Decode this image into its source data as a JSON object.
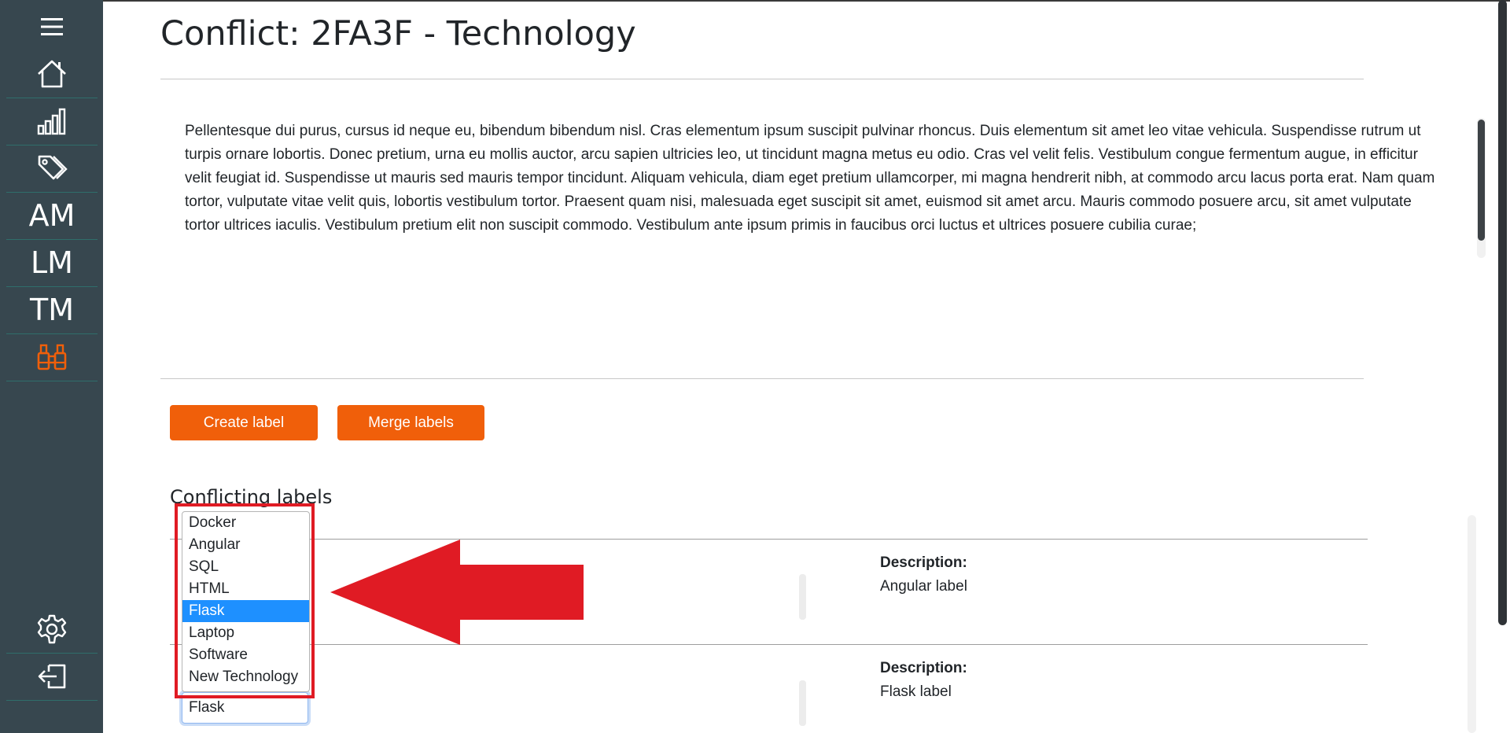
{
  "sidebar": {
    "items": [
      {
        "icon": "menu-icon"
      },
      {
        "icon": "home-icon"
      },
      {
        "icon": "bar-chart-icon"
      },
      {
        "icon": "tags-icon"
      },
      {
        "label": "AM"
      },
      {
        "label": "LM"
      },
      {
        "label": "TM"
      },
      {
        "icon": "binoculars-icon",
        "active_color": "#f05f0a"
      },
      {
        "icon": "gear-icon"
      },
      {
        "icon": "logout-icon"
      }
    ]
  },
  "page": {
    "title": "Conflict: 2FA3F - Technology",
    "paragraph": "Pellentesque dui purus, cursus id neque eu, bibendum bibendum nisl. Cras elementum ipsum suscipit pulvinar rhoncus. Duis elementum sit amet leo vitae vehicula. Suspendisse rutrum ut turpis ornare lobortis. Donec pretium, urna eu mollis auctor, arcu sapien ultricies leo, ut tincidunt magna metus eu odio. Cras vel velit felis. Vestibulum congue fermentum augue, in efficitur velit feugiat id. Suspendisse ut mauris sed mauris tempor tincidunt. Aliquam vehicula, diam eget pretium ullamcorper, mi magna hendrerit nibh, at commodo arcu lacus porta erat. Nam quam tortor, vulputate vitae velit quis, lobortis vestibulum tortor. Praesent quam nisi, malesuada eget suscipit sit amet, euismod sit amet arcu. Mauris commodo posuere arcu, sit amet vulputate tortor ultrices iaculis. Vestibulum pretium elit non suscipit commodo. Vestibulum ante ipsum primis in faucibus orci luctus et ultrices posuere cubilia curae;"
  },
  "actions": {
    "create_label": "Create label",
    "merge_labels": "Merge labels"
  },
  "conflicting": {
    "title": "Conflicting labels",
    "rows": [
      {
        "description_label": "Description:",
        "description": "Angular label"
      },
      {
        "description_label": "Description:",
        "description": "Flask label",
        "selected_value": "Flask"
      }
    ]
  },
  "dropdown": {
    "options": [
      "Docker",
      "Angular",
      "SQL",
      "HTML",
      "Flask",
      "Laptop",
      "Software",
      "New Technology"
    ],
    "highlighted": "Flask"
  },
  "colors": {
    "sidebar_bg": "#37474f",
    "accent": "#f05f0a",
    "selection": "#1e90ff",
    "annotation_red": "#e01b24"
  }
}
